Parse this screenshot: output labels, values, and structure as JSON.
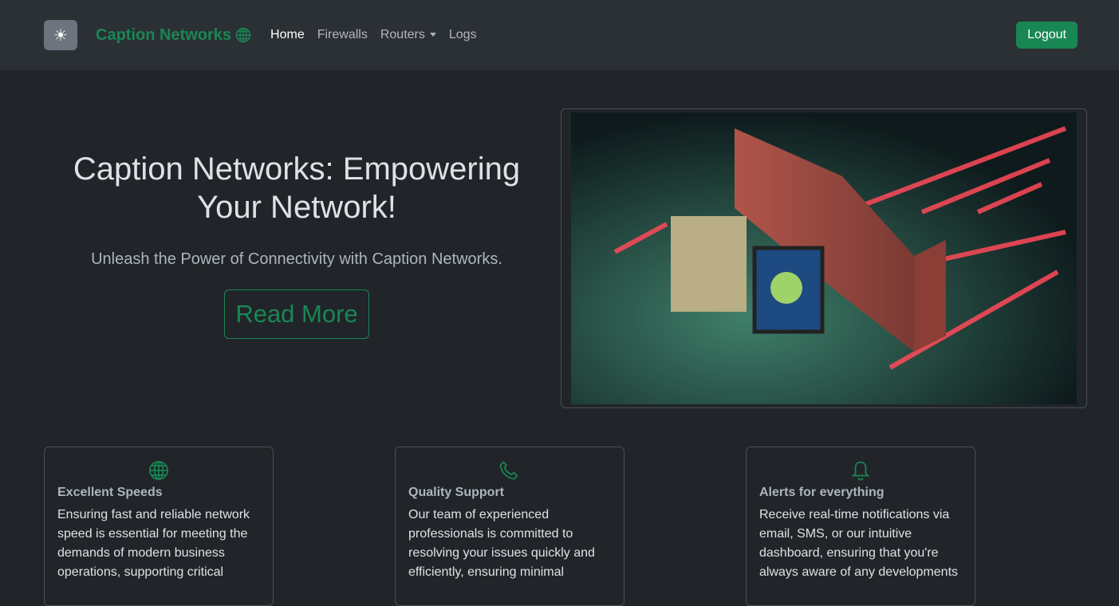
{
  "nav": {
    "brand": "Caption Networks",
    "links": [
      "Home",
      "Firewalls",
      "Routers",
      "Logs"
    ],
    "logout": "Logout"
  },
  "hero": {
    "title": "Caption Networks: Empowering Your Network!",
    "subtitle": "Unleash the Power of Connectivity with Caption Networks.",
    "button": "Read More"
  },
  "features": [
    {
      "icon": "globe-icon",
      "title": "Excellent Speeds",
      "text": "Ensuring fast and reliable network speed is essential for meeting the demands of modern business operations, supporting critical"
    },
    {
      "icon": "telephone-icon",
      "title": "Quality Support",
      "text": "Our team of experienced professionals is committed to resolving your issues quickly and efficiently, ensuring minimal"
    },
    {
      "icon": "bell-icon",
      "title": "Alerts for everything",
      "text": "Receive real-time notifications via email, SMS, or our intuitive dashboard, ensuring that you're always aware of any developments"
    }
  ],
  "colors": {
    "accent": "#198754",
    "bg": "#212529",
    "nav": "#2b3035"
  }
}
